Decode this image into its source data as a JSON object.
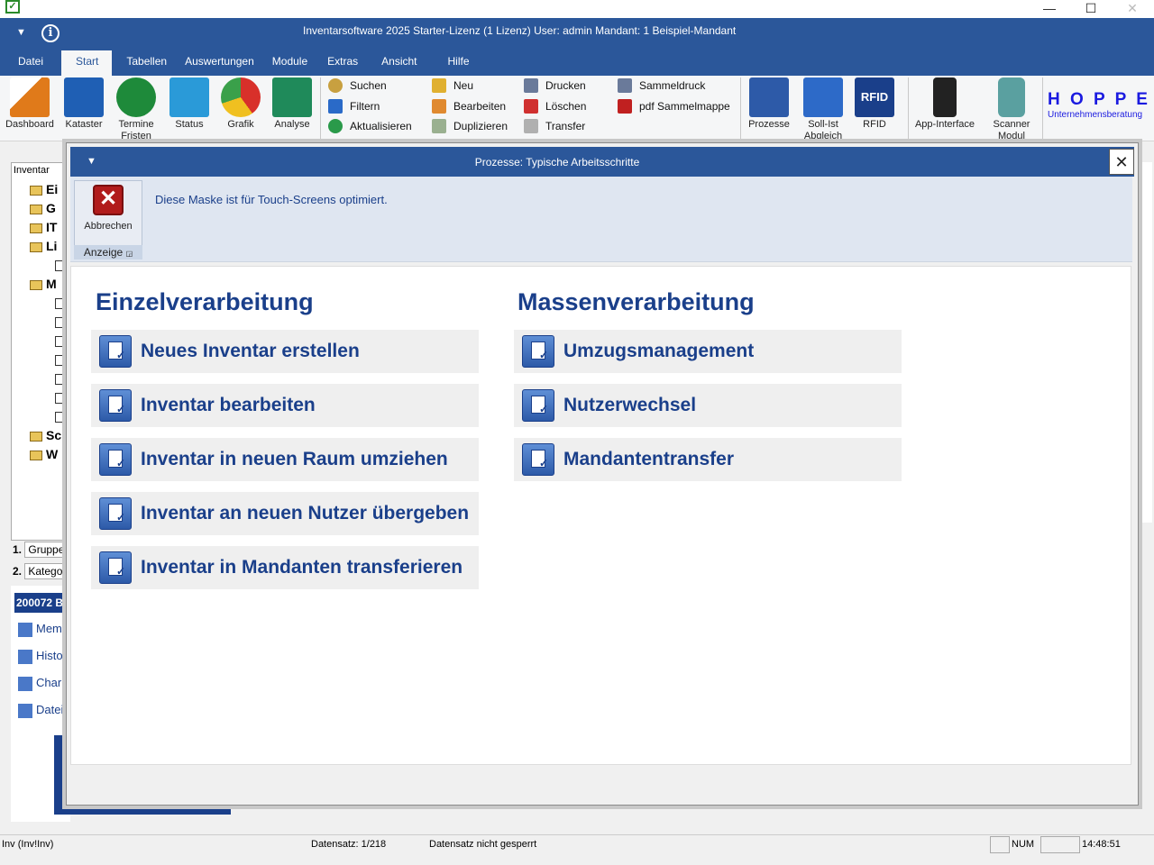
{
  "window": {
    "title": "Inventarsoftware 2025 Starter-Lizenz (1 Lizenz)   User: admin    Mandant: 1 Beispiel-Mandant"
  },
  "menu": {
    "tabs": [
      "Datei",
      "Start",
      "Tabellen",
      "Auswertungen",
      "Module",
      "Extras",
      "Ansicht",
      "Hilfe"
    ],
    "active": "Start"
  },
  "ribbon": {
    "big": [
      {
        "label": "Dashboard",
        "icon": "dashboard-chart-icon",
        "color": "#e07a1a"
      },
      {
        "label": "Kataster",
        "icon": "kataster-icon",
        "color": "#1f5fb4"
      },
      {
        "label": "Termine Fristen",
        "icon": "termine-icon",
        "color": "#1e8a3a"
      },
      {
        "label": "Status",
        "icon": "status-icon",
        "color": "#2a9ad8"
      },
      {
        "label": "Grafik",
        "icon": "pie-chart-icon",
        "color": "#d8302a"
      },
      {
        "label": "Analyse",
        "icon": "analyse-icon",
        "color": "#1f8a5a"
      }
    ],
    "small": [
      [
        "Suchen",
        "Filtern",
        "Aktualisieren"
      ],
      [
        "Neu",
        "Bearbeiten",
        "Duplizieren"
      ],
      [
        "Drucken",
        "Löschen",
        "Transfer"
      ],
      [
        "Sammeldruck",
        "pdf Sammelmappe"
      ]
    ],
    "right": [
      {
        "label": "Prozesse",
        "icon": "prozesse-icon"
      },
      {
        "label": "Soll-Ist Abgleich",
        "icon": "soll-ist-icon"
      },
      {
        "label": "RFID",
        "icon": "rfid-icon"
      },
      {
        "label": "App-Interface",
        "icon": "smartphone-icon"
      },
      {
        "label": "Scanner Modul",
        "icon": "scanner-icon"
      }
    ],
    "logo_title": "H O P P E",
    "logo_subtitle": "Unternehmensberatung"
  },
  "background": {
    "tree_header": "Inventar",
    "tree_items": [
      "Ei",
      "G",
      "IT",
      "Li",
      "M",
      "Sc",
      "W"
    ],
    "fields": [
      "Gruppe",
      "Katego"
    ],
    "field_numbers": [
      "1.",
      "2."
    ],
    "record_header": "200072 B",
    "links": [
      "Mem",
      "Histo",
      "Char",
      "Datei"
    ]
  },
  "statusbar": {
    "module": "Inv (Inv!Inv)",
    "record": "Datensatz: 1/218",
    "lock": "Datensatz nicht gesperrt",
    "num": "NUM",
    "time": "14:48:51"
  },
  "dialog": {
    "title": "Prozesse: Typische Arbeitsschritte",
    "cancel_label": "Abbrechen",
    "group_label": "Anzeige",
    "note": "Diese Maske ist für Touch-Screens optimiert.",
    "single": {
      "title": "Einzelverarbeitung",
      "items": [
        "Neues Inventar erstellen",
        "Inventar bearbeiten",
        "Inventar in neuen Raum umziehen",
        "Inventar an neuen Nutzer übergeben",
        "Inventar in Mandanten transferieren"
      ]
    },
    "mass": {
      "title": "Massenverarbeitung",
      "items": [
        "Umzugsmanagement",
        "Nutzerwechsel",
        "Mandantentransfer"
      ]
    }
  }
}
